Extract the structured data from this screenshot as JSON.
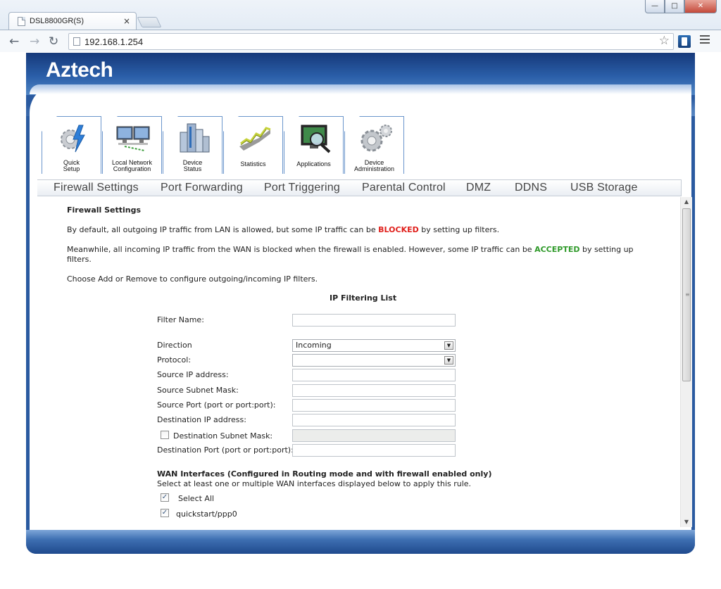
{
  "browser": {
    "tab_title": "DSL8800GR(S)",
    "tab_close": "×",
    "url": "192.168.1.254",
    "window_buttons": [
      "minimize-icon",
      "maximize-icon",
      "close-icon"
    ]
  },
  "router": {
    "logo": "Aztech",
    "icon_tabs": [
      {
        "label1": "Quick",
        "label2": "Setup",
        "icon": "gear-lightning-icon"
      },
      {
        "label1": "Local Network",
        "label2": "Configuration",
        "icon": "monitors-icon"
      },
      {
        "label1": "Device",
        "label2": "Status",
        "icon": "buildings-icon"
      },
      {
        "label1": "Statistics",
        "label2": "",
        "icon": "graph-icon"
      },
      {
        "label1": "Applications",
        "label2": "",
        "icon": "magnifier-monitor-icon"
      },
      {
        "label1": "Device",
        "label2": "Administration",
        "icon": "gears-icon"
      }
    ],
    "sub_nav": [
      "Firewall Settings",
      "Port Forwarding",
      "Port Triggering",
      "Parental Control",
      "DMZ",
      "DDNS",
      "USB Storage"
    ]
  },
  "content": {
    "heading": "Firewall Settings",
    "para1_a": "By default, all outgoing IP traffic from LAN is allowed, but some IP traffic can be ",
    "para1_red": "BLOCKED",
    "para1_b": " by setting up filters.",
    "para2_a": "Meanwhile, all incoming IP traffic from the WAN is blocked when the firewall is enabled. However, some IP traffic can be ",
    "para2_green": "ACCEPTED",
    "para2_b": " by setting up",
    "para2_c": "filters.",
    "para3": "Choose Add or Remove to configure outgoing/incoming IP filters.",
    "list_title": "IP Filtering List",
    "form": {
      "filter_name_label": "Filter Name:",
      "filter_name_value": "",
      "direction_label": "Direction",
      "direction_value": "Incoming",
      "protocol_label": "Protocol:",
      "protocol_value": "",
      "src_ip_label": "Source IP address:",
      "src_mask_label": "Source Subnet Mask:",
      "src_port_label": "Source Port (port or port:port):",
      "dst_ip_label": "Destination IP address:",
      "dst_mask_label": "Destination Subnet Mask:",
      "dst_mask_checked": false,
      "dst_port_label": "Destination Port (port or port:port):"
    },
    "wan_title": "WAN Interfaces (Configured in Routing mode and with firewall enabled only)",
    "wan_desc": "Select at least one or multiple WAN interfaces displayed below to apply this rule.",
    "select_all_label": "Select All",
    "select_all_checked": true,
    "interfaces": [
      {
        "name": "quickstart/ppp0",
        "checked": true
      }
    ]
  },
  "colors": {
    "header_blue": "#2a5aa0",
    "blocked_red": "#e0201c",
    "accepted_green": "#2f9a2a"
  }
}
